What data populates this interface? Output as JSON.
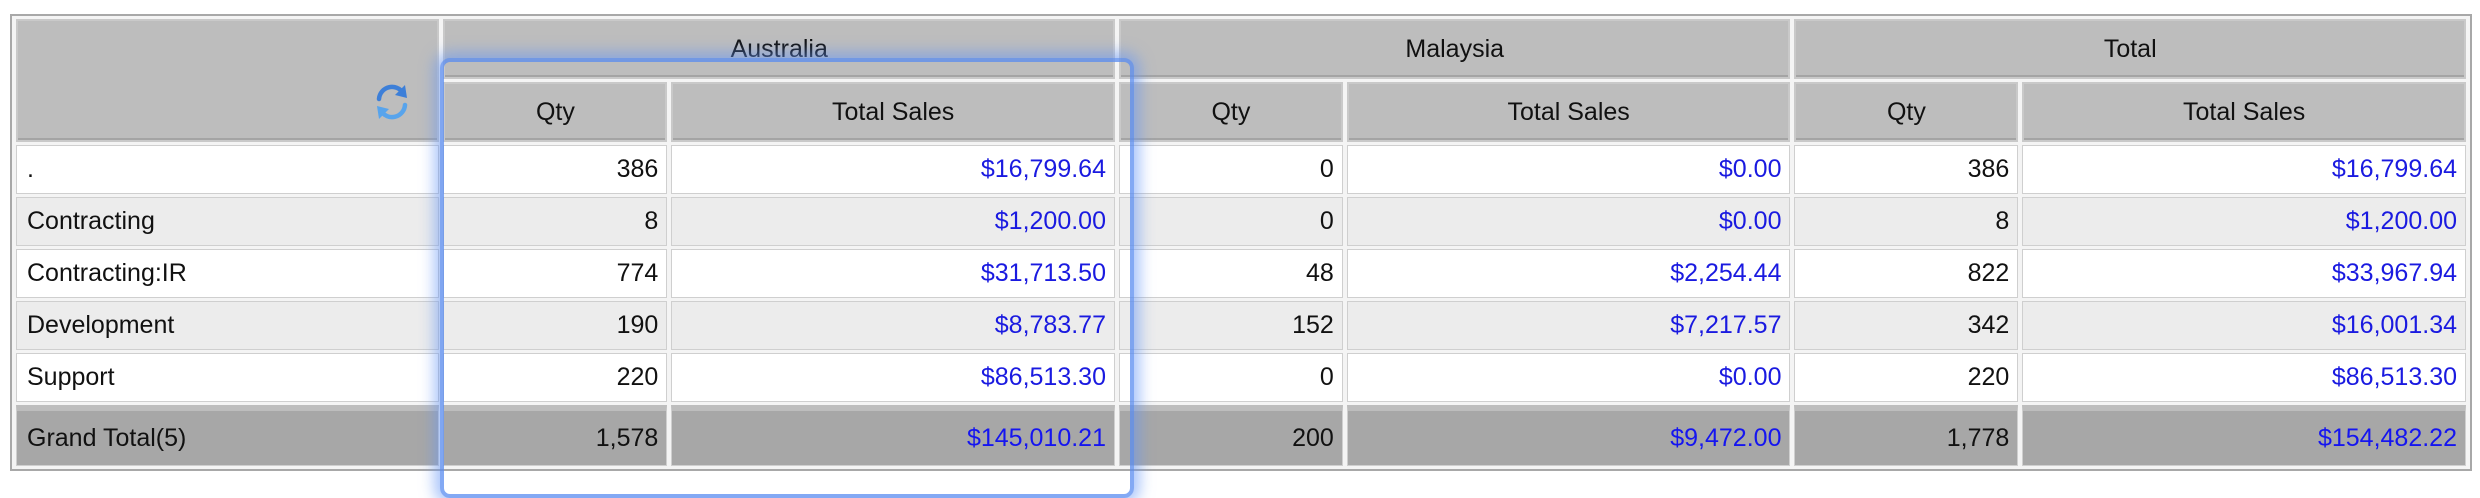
{
  "columns": {
    "groups": [
      "Australia",
      "Malaysia",
      "Total"
    ],
    "qty_label": "Qty",
    "sales_label": "Total Sales"
  },
  "refresh_icon": "refresh-icon",
  "rows": [
    {
      "label": ".",
      "au_qty": "386",
      "au_sales": "$16,799.64",
      "my_qty": "0",
      "my_sales": "$0.00",
      "tot_qty": "386",
      "tot_sales": "$16,799.64"
    },
    {
      "label": "Contracting",
      "au_qty": "8",
      "au_sales": "$1,200.00",
      "my_qty": "0",
      "my_sales": "$0.00",
      "tot_qty": "8",
      "tot_sales": "$1,200.00"
    },
    {
      "label": "Contracting:IR",
      "au_qty": "774",
      "au_sales": "$31,713.50",
      "my_qty": "48",
      "my_sales": "$2,254.44",
      "tot_qty": "822",
      "tot_sales": "$33,967.94"
    },
    {
      "label": "Development",
      "au_qty": "190",
      "au_sales": "$8,783.77",
      "my_qty": "152",
      "my_sales": "$7,217.57",
      "tot_qty": "342",
      "tot_sales": "$16,001.34"
    },
    {
      "label": "Support",
      "au_qty": "220",
      "au_sales": "$86,513.30",
      "my_qty": "0",
      "my_sales": "$0.00",
      "tot_qty": "220",
      "tot_sales": "$86,513.30"
    }
  ],
  "grand_total": {
    "label": "Grand Total(5)",
    "au_qty": "1,578",
    "au_sales": "$145,010.21",
    "my_qty": "200",
    "my_sales": "$9,472.00",
    "tot_qty": "1,778",
    "tot_sales": "$154,482.22"
  },
  "colors": {
    "header_bg": "#bdbdbd",
    "grand_total_bg": "#a7a7a7",
    "money_text": "#1a1ae0",
    "highlight": "#5a8cf0"
  }
}
